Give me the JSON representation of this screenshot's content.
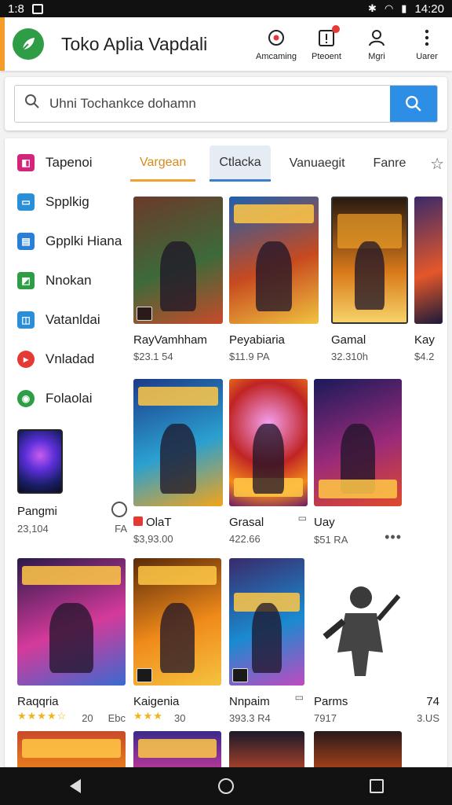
{
  "status_bar": {
    "time_left": "1:8",
    "time_right": "14:20"
  },
  "header": {
    "title": "Toko Aplia Vapdali",
    "actions": [
      {
        "icon": "target-icon",
        "label": "Amcaming"
      },
      {
        "icon": "notification-icon",
        "label": "Pteoent"
      },
      {
        "icon": "user-icon",
        "label": "Mgri"
      },
      {
        "icon": "kebab-menu-icon",
        "label": "Uarer"
      }
    ]
  },
  "search": {
    "value": "Uhni Tochankce dohamn"
  },
  "sidebar": {
    "items": [
      {
        "label": "Tapenoi",
        "color": "#d4257a",
        "glyph": "◧"
      },
      {
        "label": "Spplkig",
        "color": "#2a8fd8",
        "glyph": "▭"
      },
      {
        "label": "Gpplki Hiana",
        "color": "#2a7fd6",
        "glyph": "▤"
      },
      {
        "label": "Nnokan",
        "color": "#2e9d46",
        "glyph": "◩"
      },
      {
        "label": "Vatanldai",
        "color": "#2a8fd8",
        "glyph": "◫"
      },
      {
        "label": "Vnladad",
        "color": "#e53935",
        "glyph": "▸"
      },
      {
        "label": "Folaolai",
        "color": "#2e9d46",
        "glyph": "◉"
      }
    ],
    "featured": {
      "name": "Pangmi",
      "meta_left": "23,104",
      "meta_right": "FA"
    }
  },
  "tabs": {
    "items": [
      "Vargean",
      "Ctlacka",
      "Vanuaegit",
      "Fanre"
    ]
  },
  "cards": [
    {
      "name": "RayVamhham",
      "price": "$23.1 54",
      "colors": [
        "#6b3a2a",
        "#3d6a3a",
        "#c84a2a"
      ]
    },
    {
      "name": "Peyabiaria",
      "price": "$11.9 PA",
      "colors": [
        "#1f5fae",
        "#c74a1f",
        "#f0c340"
      ]
    },
    {
      "name": "Gamal",
      "price": "32.310h",
      "colors": [
        "#2a1a10",
        "#d97a1a",
        "#f6d36a"
      ]
    },
    {
      "name": "Kay",
      "price": "$4.2",
      "colors": [
        "#3a2a6a",
        "#e4572a",
        "#1a1a3a"
      ]
    },
    {
      "name": "OlaT",
      "price": "$3,93.00",
      "colors": [
        "#1d3a8a",
        "#2aa0d0",
        "#f3a41a"
      ]
    },
    {
      "name": "Grasal",
      "price": "422.66",
      "colors": [
        "#c02424",
        "#f38a1a",
        "#6a1a6a"
      ]
    },
    {
      "name": "Uay",
      "price": "$51 RA",
      "colors": [
        "#1a1a5a",
        "#9a2a7a",
        "#e04a2a"
      ]
    },
    {
      "name": "Raqqria",
      "price": "",
      "rating": "20",
      "extra": "Ebc",
      "colors": [
        "#2a1a4a",
        "#d43a9a",
        "#3a6ad0"
      ]
    },
    {
      "name": "Kaigenia",
      "price": "",
      "rating": "30",
      "colors": [
        "#5a2a0a",
        "#f08a1a",
        "#f4c340"
      ]
    },
    {
      "name": "Nnpaim",
      "price": "393.3 R4",
      "colors": [
        "#3a2a6a",
        "#1a8ad0",
        "#c04ac0"
      ]
    },
    {
      "name": "Parms",
      "price": "7917",
      "side_a": "74",
      "side_b": "3.US",
      "colors": [
        "#ffffff",
        "#f4f4f4",
        "#ffffff"
      ]
    }
  ],
  "stars": "★★★★☆",
  "stars_three": "★★★",
  "nav": {
    "back": "back",
    "home": "home",
    "recent": "recent"
  }
}
